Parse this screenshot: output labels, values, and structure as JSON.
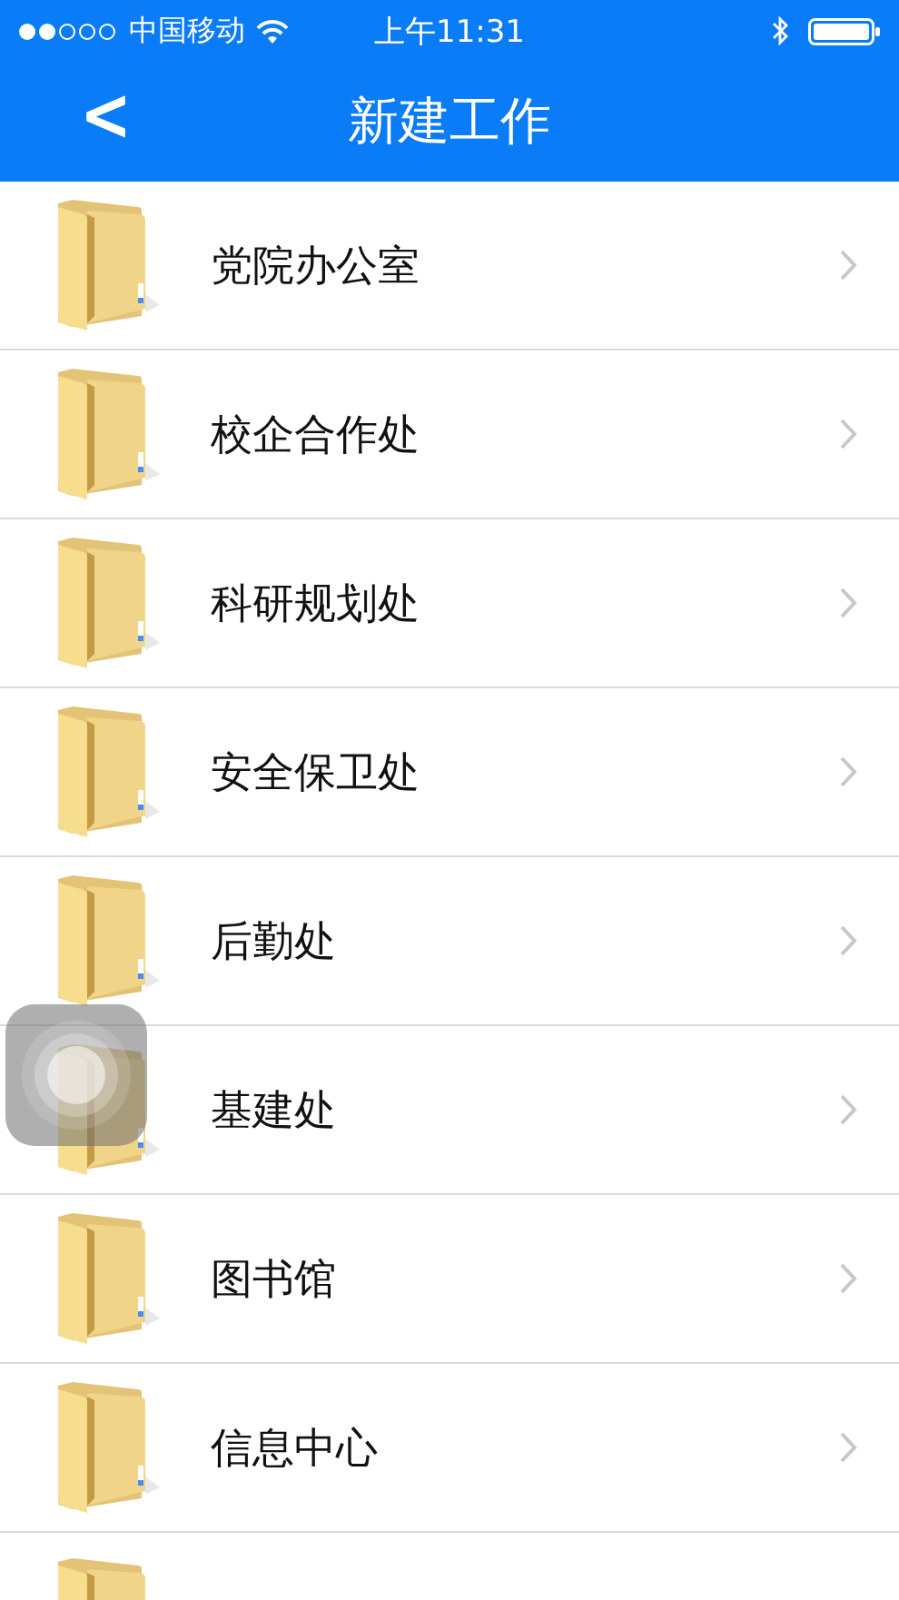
{
  "status_bar": {
    "carrier": "中国移动",
    "time": "上午11:31"
  },
  "nav_bar": {
    "back": "<",
    "title": "新建工作"
  },
  "items": [
    {
      "kind": "folder",
      "label": "党院办公室"
    },
    {
      "kind": "folder",
      "label": "校企合作处"
    },
    {
      "kind": "folder",
      "label": "科研规划处"
    },
    {
      "kind": "folder",
      "label": "安全保卫处"
    },
    {
      "kind": "folder",
      "label": "后勤处"
    },
    {
      "kind": "folder",
      "label": "基建处"
    },
    {
      "kind": "folder",
      "label": "图书馆"
    },
    {
      "kind": "folder",
      "label": "信息中心"
    },
    {
      "kind": "cut"
    }
  ]
}
